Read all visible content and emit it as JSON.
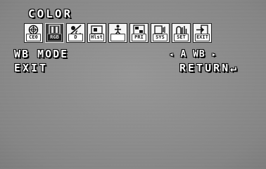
{
  "menu": {
    "title": "COLOR",
    "icons": [
      {
        "label": "CE0",
        "icon": "camera-iris-icon",
        "selected": false
      },
      {
        "label": "RGB",
        "icon": "color-rgb-icon",
        "selected": true
      },
      {
        "label": "D",
        "icon": "day-night-icon",
        "selected": false
      },
      {
        "label": "Hlst",
        "icon": "highlight-icon",
        "selected": false
      },
      {
        "label": "",
        "icon": "motion-person-icon",
        "selected": false
      },
      {
        "label": "PRI",
        "icon": "privacy-mask-icon",
        "selected": false
      },
      {
        "label": "SYS",
        "icon": "system-icon",
        "selected": false
      },
      {
        "label": "SET",
        "icon": "setup-icon",
        "selected": false
      },
      {
        "label": "EXIT",
        "icon": "exit-icon",
        "selected": false
      }
    ]
  },
  "settings": {
    "wb_mode_label": "WB  MODE",
    "wb_mode_value": "A WB",
    "left_arrow": "◂",
    "right_arrow": "▸"
  },
  "footer": {
    "exit_label": "EXIT",
    "return_label": "RETURN↵"
  }
}
